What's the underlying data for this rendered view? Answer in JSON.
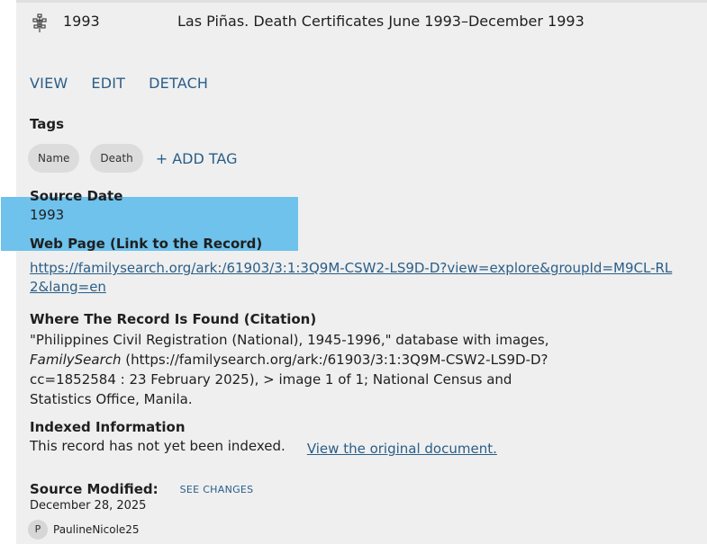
{
  "source": {
    "year": "1993",
    "title": "Las Piñas. Death Certificates June 1993–December 1993",
    "icon": "tree-icon"
  },
  "actions": {
    "view": "VIEW",
    "edit": "EDIT",
    "detach": "DETACH"
  },
  "tags": {
    "label": "Tags",
    "items": [
      "Name",
      "Death"
    ],
    "add_label": "+ ADD TAG"
  },
  "source_date": {
    "label": "Source Date",
    "value": "1993"
  },
  "web_page": {
    "label": "Web Page (Link to the Record)",
    "url": "https://familysearch.org/ark:/61903/3:1:3Q9M-CSW2-LS9D-D?view=explore&groupId=M9CL-RL2&lang=en"
  },
  "citation": {
    "label": "Where The Record Is Found (Citation)",
    "part1": "\"Philippines Civil Registration (National), 1945-1996,\" database with images,",
    "italic": "FamilySearch",
    "part2": " (https://familysearch.org/ark:/61903/3:1:3Q9M-CSW2-LS9D-D?cc=1852584 : 23 February 2025),  > image 1 of 1; National Census and Statistics Office, Manila."
  },
  "indexed": {
    "label": "Indexed Information",
    "text": "This record has not yet been indexed.",
    "link": "View the original document."
  },
  "modified": {
    "label": "Source Modified:",
    "see_changes": "SEE CHANGES",
    "date": "December 28, 2025",
    "user_initial": "P",
    "user": "PaulineNicole25"
  },
  "colors": {
    "link": "#2a5e88",
    "highlight": "#6ec2ec",
    "panel": "#efefef"
  }
}
